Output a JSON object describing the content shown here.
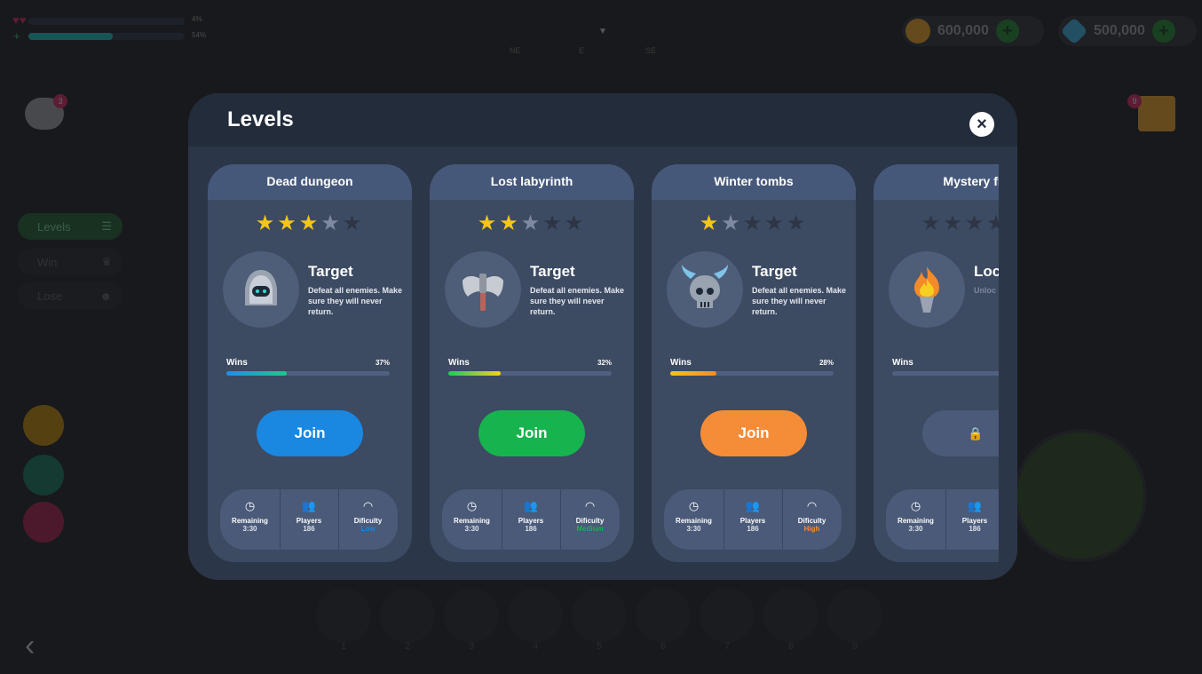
{
  "hud": {
    "health_pct_label": "4%",
    "shield_pct_label": "54%",
    "compass_labels": [
      "NE",
      "E",
      "SE"
    ],
    "currencies": [
      {
        "name": "coins",
        "value": "600,000",
        "color": "#f5a623"
      },
      {
        "name": "gems",
        "value": "500,000",
        "color": "#3bb4e8"
      }
    ],
    "chat_badge": "3",
    "map_badge": "9",
    "side_menu": [
      {
        "label": "Levels",
        "icon": "list-icon",
        "active": true
      },
      {
        "label": "Win",
        "icon": "crown-icon",
        "active": false
      },
      {
        "label": "Lose",
        "icon": "skull-icon",
        "active": false
      }
    ],
    "inventory_slots": [
      "1",
      "2",
      "3",
      "4",
      "5",
      "6",
      "7",
      "8",
      "9"
    ]
  },
  "modal": {
    "title": "Levels",
    "close_label": "×",
    "cards": [
      {
        "title": "Dead dungeon",
        "stars": 3,
        "max_stars": 5,
        "target_title": "Target",
        "target_desc": "Defeat all enemies. Make sure they will never return.",
        "avatar_icon": "hooded-robot-icon",
        "wins_label": "Wins",
        "wins_pct": "37%",
        "wins_fraction": 0.37,
        "bar_colors": [
          "#1f8ee8",
          "#1ec88a"
        ],
        "join_label": "Join",
        "join_color": "#1a87e0",
        "locked": false,
        "remaining_label": "Remaining",
        "remaining_value": "3:30",
        "players_label": "Players",
        "players_value": "186",
        "difficulty_label": "Dificulty",
        "difficulty_value": "Low",
        "difficulty_color": "#1a87e0"
      },
      {
        "title": "Lost labyrinth",
        "stars": 2,
        "max_stars": 5,
        "target_title": "Target",
        "target_desc": "Defeat all enemies. Make sure they will never return.",
        "avatar_icon": "battle-axe-icon",
        "wins_label": "Wins",
        "wins_pct": "32%",
        "wins_fraction": 0.32,
        "bar_colors": [
          "#20c860",
          "#f5d020"
        ],
        "join_label": "Join",
        "join_color": "#17b34f",
        "locked": false,
        "remaining_label": "Remaining",
        "remaining_value": "3:30",
        "players_label": "Players",
        "players_value": "186",
        "difficulty_label": "Dificulty",
        "difficulty_value": "Medium",
        "difficulty_color": "#17b34f"
      },
      {
        "title": "Winter tombs",
        "stars": 1,
        "max_stars": 5,
        "target_title": "Target",
        "target_desc": "Defeat all enemies. Make sure they will never return.",
        "avatar_icon": "horned-skull-icon",
        "wins_label": "Wins",
        "wins_pct": "28%",
        "wins_fraction": 0.28,
        "bar_colors": [
          "#f7c21b",
          "#f58a2a"
        ],
        "join_label": "Join",
        "join_color": "#f58c38",
        "locked": false,
        "remaining_label": "Remaining",
        "remaining_value": "3:30",
        "players_label": "Players",
        "players_value": "186",
        "difficulty_label": "Dificulty",
        "difficulty_value": "High",
        "difficulty_color": "#f58c38"
      },
      {
        "title": "Mystery fla",
        "stars": 0,
        "max_stars": 5,
        "target_title": "Loc",
        "target_desc": "Unloc reachi points",
        "avatar_icon": "torch-flame-icon",
        "wins_label": "Wins",
        "wins_pct": "",
        "wins_fraction": 0,
        "bar_colors": [
          "#506080",
          "#506080"
        ],
        "join_label": "",
        "join_color": "#4a5a78",
        "locked": true,
        "remaining_label": "Remaining",
        "remaining_value": "3:30",
        "players_label": "Players",
        "players_value": "186",
        "difficulty_label": "",
        "difficulty_value": "",
        "difficulty_color": "#dce2ea"
      }
    ]
  }
}
